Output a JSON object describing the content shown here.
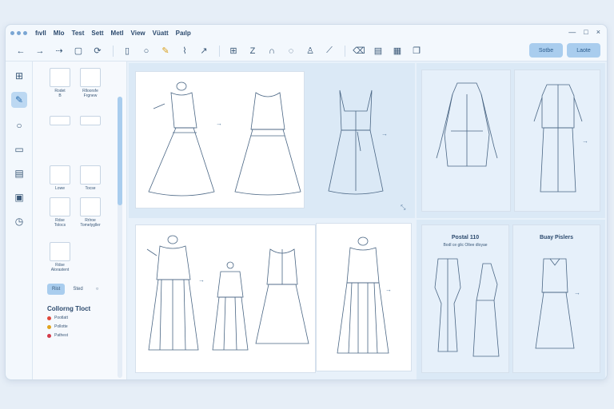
{
  "menubar": {
    "items": [
      "fıvll",
      "Mlo",
      "Test",
      "Sett",
      "Metl",
      "View",
      "Vüatt",
      "Paılp"
    ],
    "window_controls": [
      "—",
      "□",
      "×"
    ]
  },
  "toolbar": {
    "icons": [
      "back-icon",
      "forward-icon",
      "redo-icon",
      "file-icon",
      "history-icon",
      "page-icon",
      "circle-icon",
      "pen-icon",
      "pin-icon",
      "curve-icon",
      "grid-icon",
      "zigzag-icon",
      "magnet-icon",
      "rotate-icon",
      "person-icon",
      "lasso-icon",
      "eraser-icon",
      "layers-icon",
      "grid-icon",
      "copy-icon"
    ],
    "button_1": "Sotbe",
    "button_2": "Laote"
  },
  "library": {
    "items": [
      {
        "label": "Rodet\nB"
      },
      {
        "label": "Rlloorsfe\nFrgnew"
      },
      {
        "label": "Lowe"
      },
      {
        "label": "Tocse"
      },
      {
        "label": "Rdse\nTolocs"
      },
      {
        "label": "Rrlroe\nTomelygller"
      },
      {
        "label": "Rdse\nAlorastent"
      }
    ],
    "chips": [
      "Rist",
      "Sted",
      "○"
    ],
    "section_title": "Collorng Tloct",
    "legend": [
      {
        "label": "Pootlatt",
        "color": "#e0473a"
      },
      {
        "label": "Pollotte",
        "color": "#e0a31d"
      },
      {
        "label": "Pathest",
        "color": "#d33a4a"
      }
    ]
  },
  "canvas": {
    "card_a_title": "Postal 110",
    "card_a_sub": "Bodl ce glic Oltee dloyae",
    "card_b_title": "Buay Pislers"
  },
  "colors": {
    "accent": "#a9cdee",
    "panel": "#dbe9f6",
    "line": "#4a6684"
  }
}
